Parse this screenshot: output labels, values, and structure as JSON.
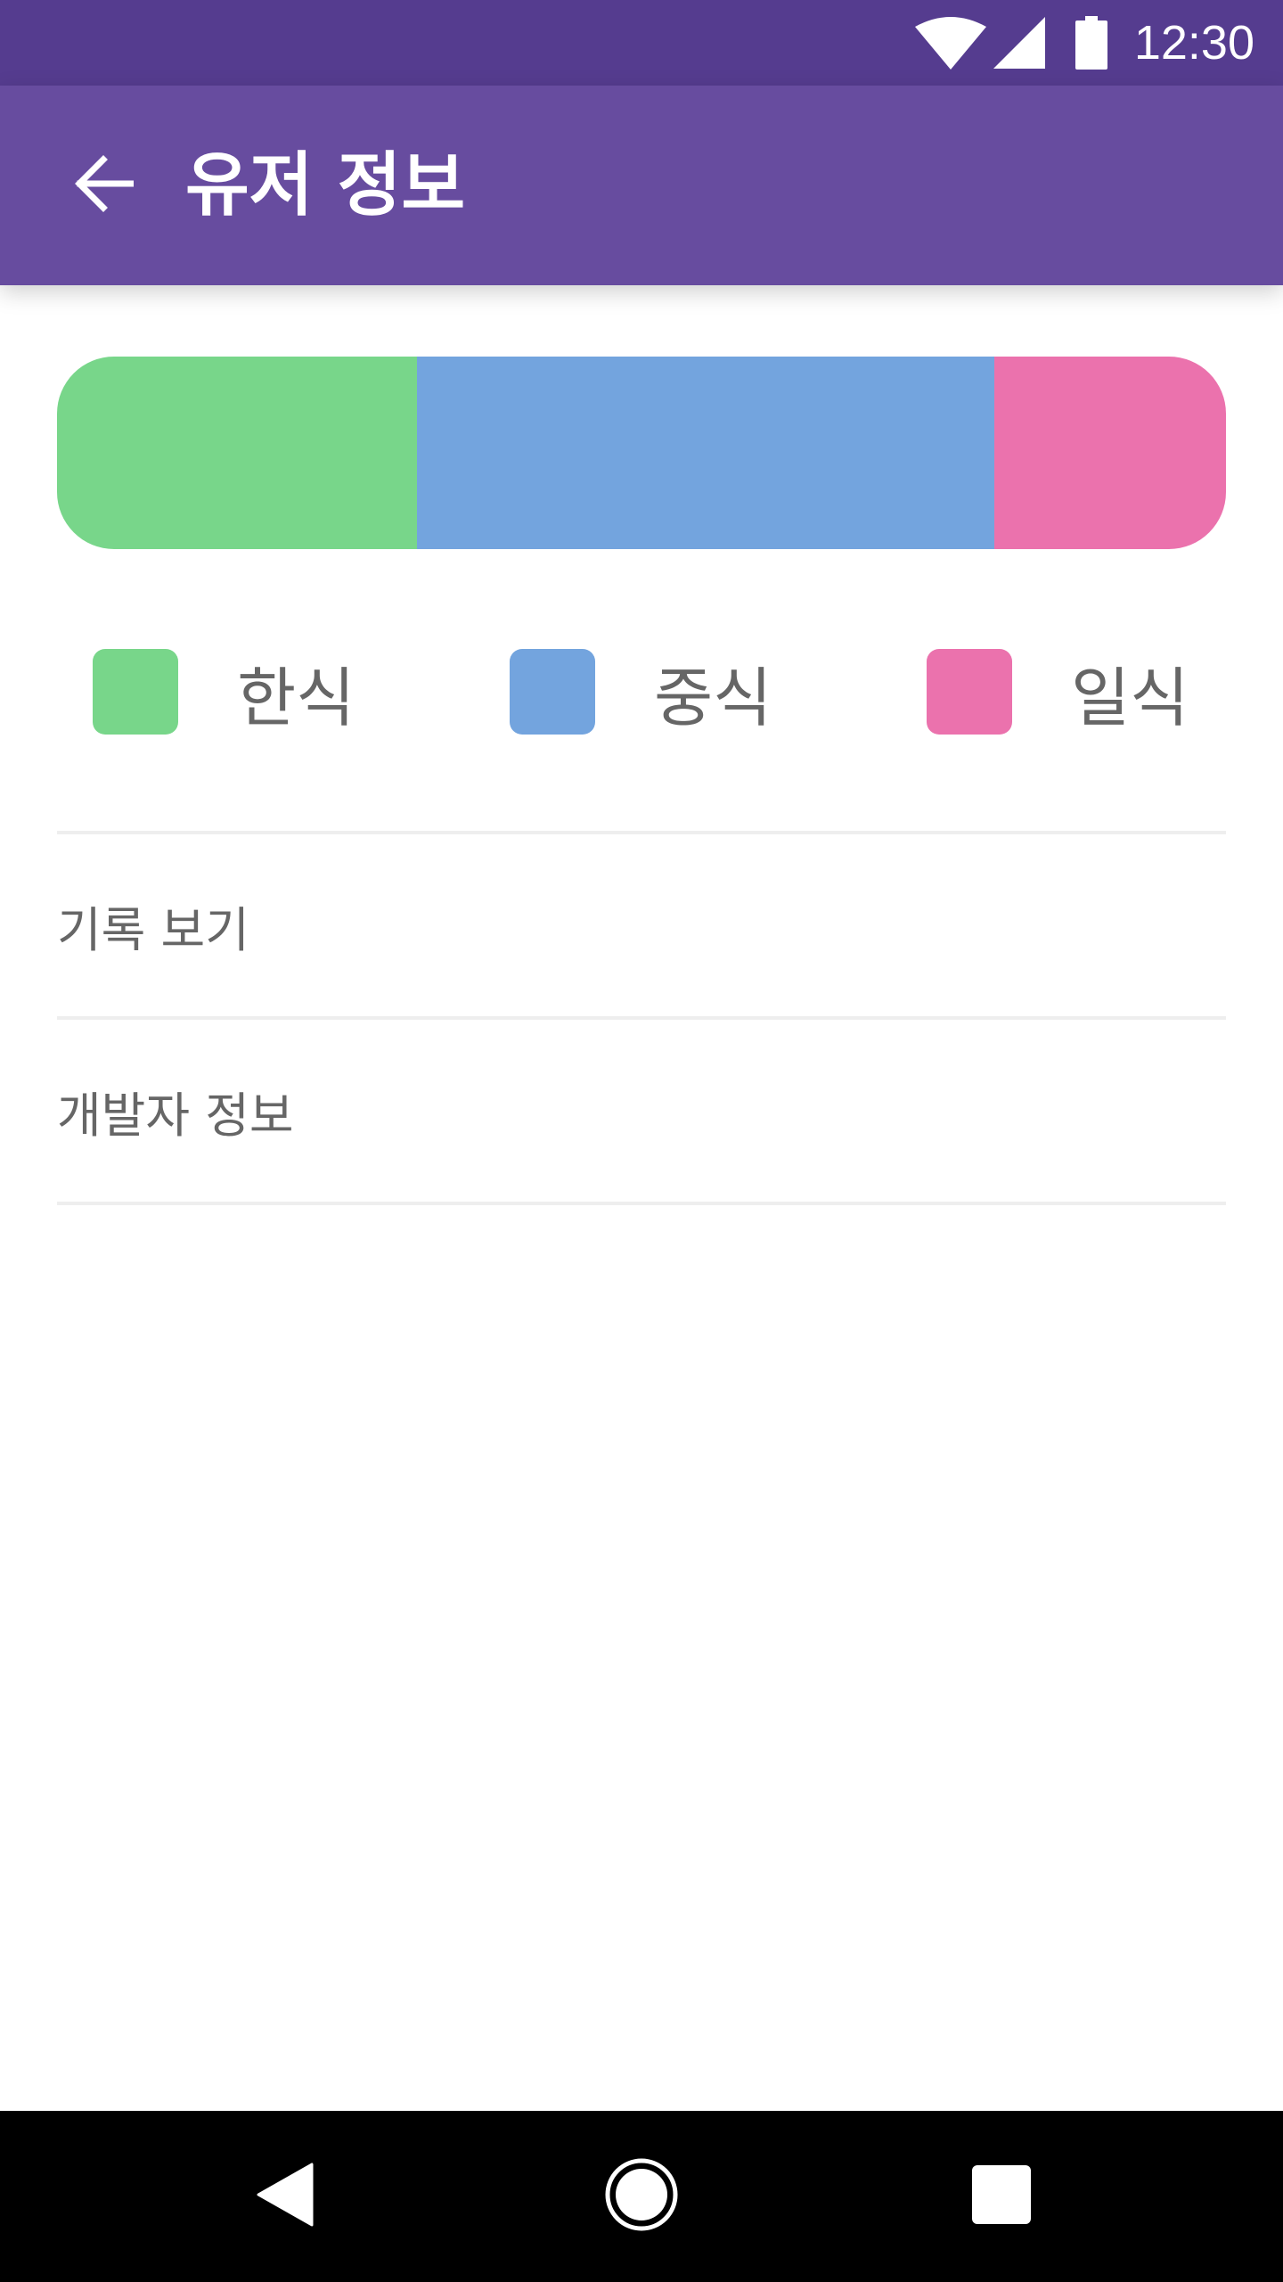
{
  "status_bar": {
    "time": "12:30",
    "icons": [
      "wifi-icon",
      "cell-signal-icon",
      "battery-icon"
    ]
  },
  "app_bar": {
    "back_icon": "arrow-left-icon",
    "title": "유저 정보",
    "color": "#674c9f"
  },
  "ratio_bar": {
    "segments": [
      {
        "name": "한식",
        "fraction": 0.308,
        "color": "#78d68a"
      },
      {
        "name": "중식",
        "fraction": 0.494,
        "color": "#73a4de"
      },
      {
        "name": "일식",
        "fraction": 0.198,
        "color": "#eb72ad"
      }
    ]
  },
  "legend": {
    "items": [
      {
        "label": "한식",
        "color": "#78d68a"
      },
      {
        "label": "중식",
        "color": "#73a4de"
      },
      {
        "label": "일식",
        "color": "#eb72ad"
      }
    ]
  },
  "menu": {
    "items": [
      {
        "label": "기록 보기"
      },
      {
        "label": "개발자 정보"
      }
    ]
  },
  "nav_bar": {
    "buttons": [
      "back-triangle-icon",
      "home-circle-icon",
      "recents-square-icon"
    ]
  }
}
